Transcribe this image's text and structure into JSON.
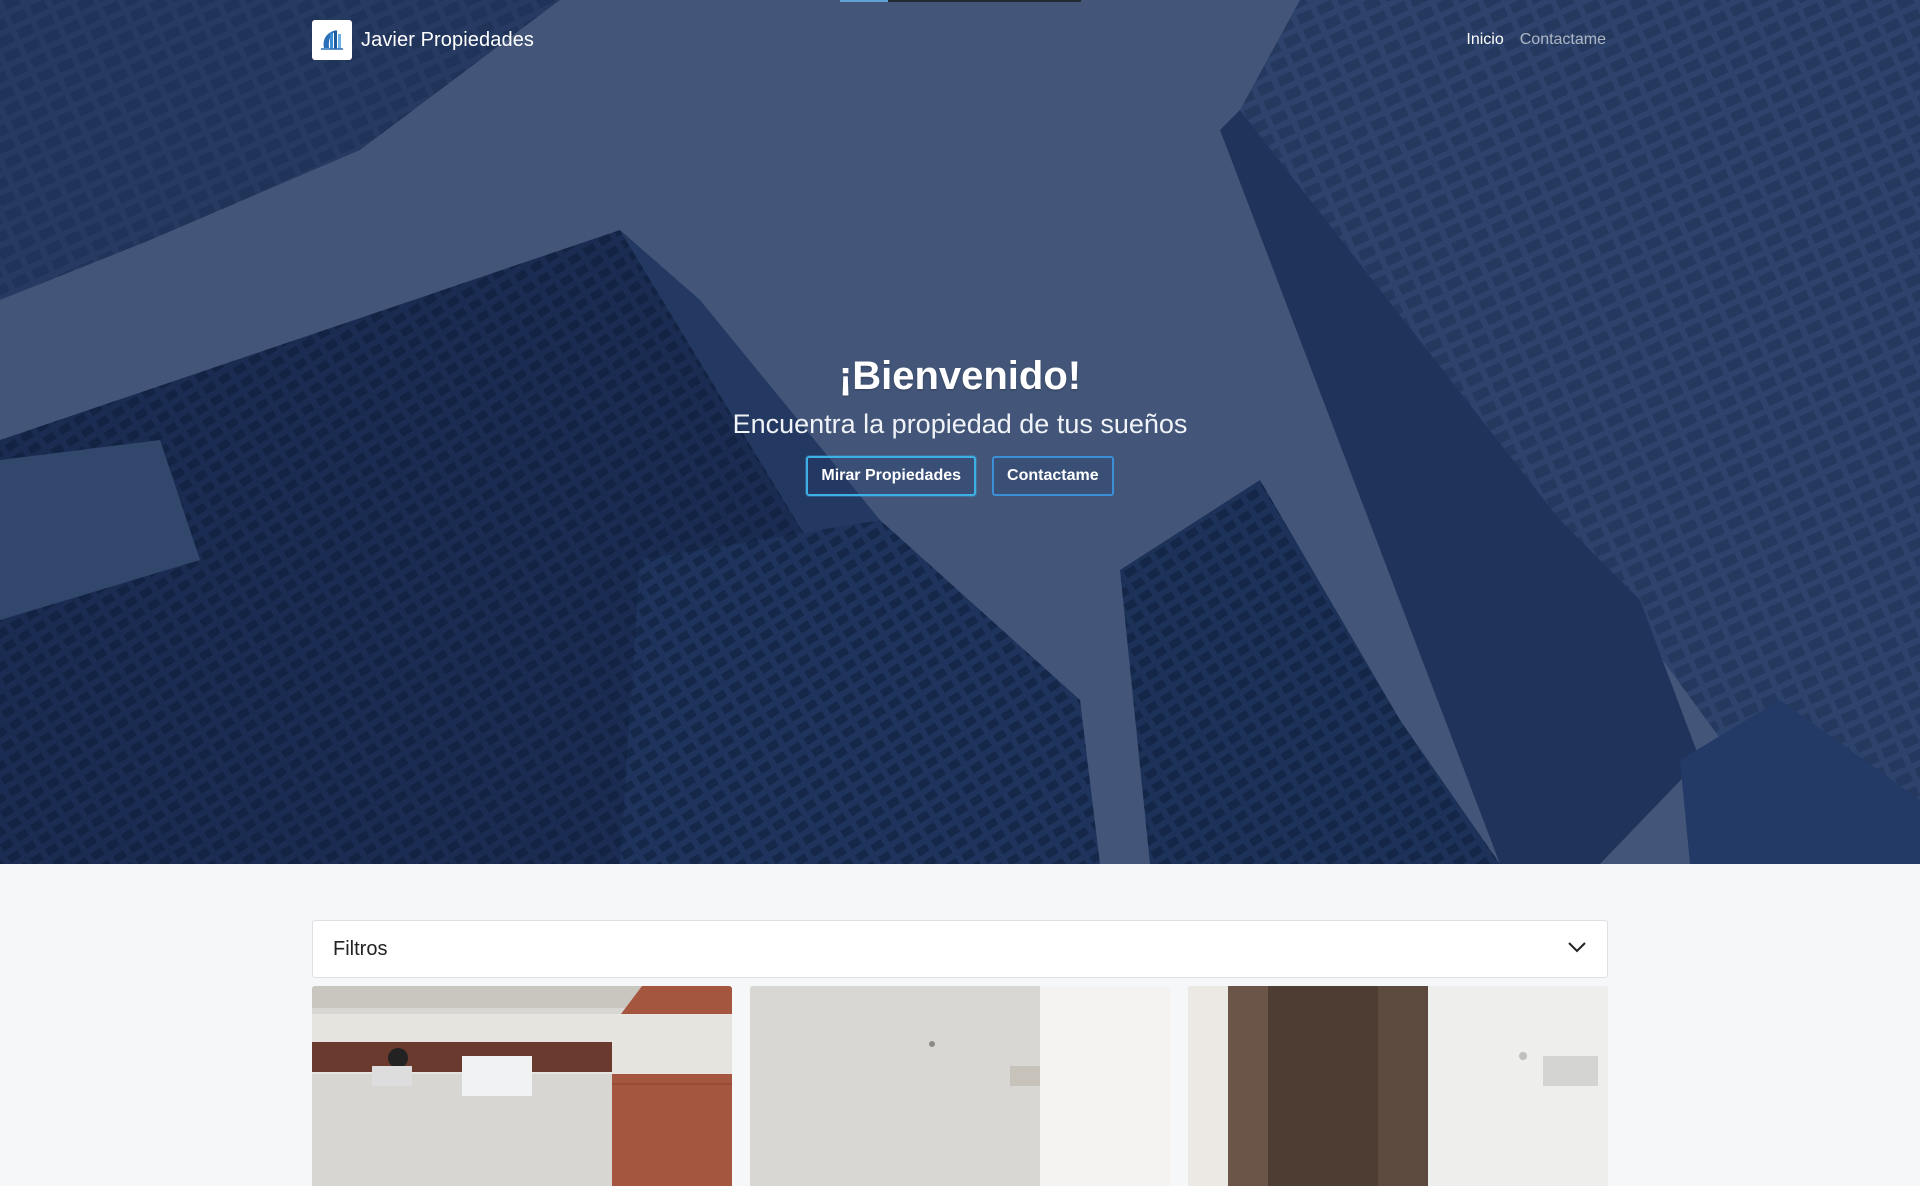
{
  "navbar": {
    "brand_name": "Javier Propiedades",
    "links": [
      {
        "label": "Inicio",
        "active": true
      },
      {
        "label": "Contactame",
        "active": false
      }
    ]
  },
  "hero": {
    "title": "¡Bienvenido!",
    "subtitle": "Encuentra la propiedad de tus sueños",
    "buttons": {
      "primary_label": "Mirar Propiedades",
      "secondary_label": "Contactame"
    }
  },
  "filters": {
    "title": "Filtros",
    "expanded": false
  },
  "properties": [
    {
      "image": "interior-brick-wall-photo"
    },
    {
      "image": "interior-white-room-photo"
    },
    {
      "image": "interior-wood-panel-photo"
    }
  ],
  "colors": {
    "accent_border": "#3a8fd6",
    "hero_overlay": "#14264e",
    "page_background": "#f6f7f9"
  }
}
